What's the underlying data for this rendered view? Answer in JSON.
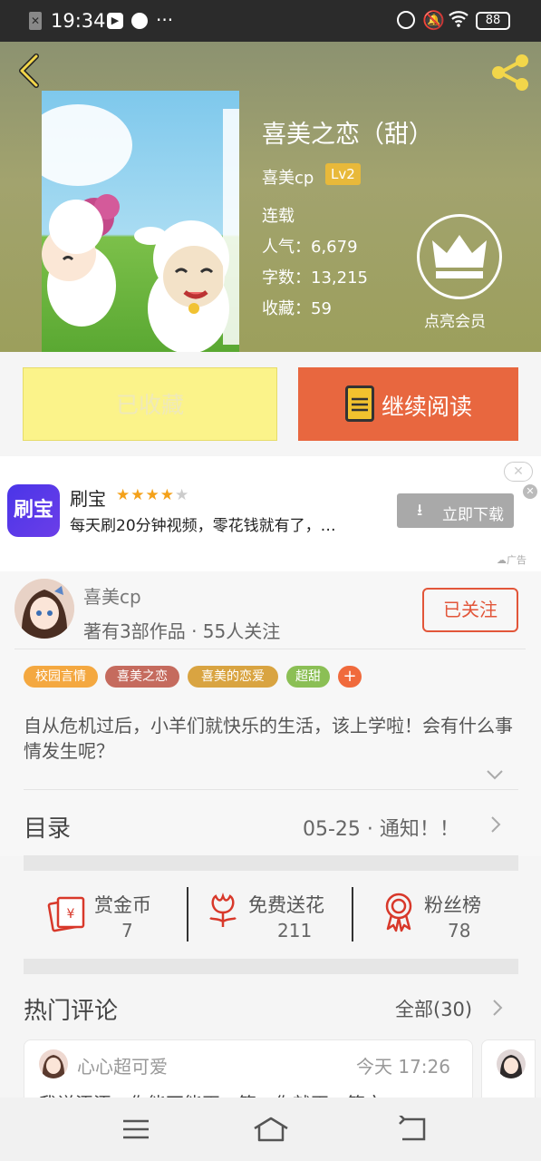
{
  "status_bar": {
    "time": "19:34",
    "dots": "···",
    "battery": "88"
  },
  "book": {
    "title": "喜美之恋（甜）",
    "author": "喜美cp",
    "level": "Lv2",
    "status": "连载",
    "popularity": "人气：6,679",
    "word_count": "字数：13,215",
    "favorites": "收藏：59",
    "vip_label": "点亮会员"
  },
  "actions": {
    "collected": "已收藏",
    "continue_reading": "继续阅读"
  },
  "ad": {
    "app_icon_text": "刷宝",
    "app_name": "刷宝",
    "rating": 4,
    "description": "每天刷20分钟视频，零花钱就有了，…",
    "download": "立即下载",
    "ad_label": "广告"
  },
  "author_card": {
    "name": "喜美cp",
    "stats": "著有3部作品 · 55人关注",
    "follow": "已关注"
  },
  "tags": [
    {
      "label": "校园言情",
      "color": "#f4a840"
    },
    {
      "label": "喜美之恋",
      "color": "#c56b5e"
    },
    {
      "label": "喜美的恋爱",
      "color": "#d9a441"
    },
    {
      "label": "超甜",
      "color": "#8bbf55"
    },
    {
      "label": "+",
      "color": "#f06a3c"
    }
  ],
  "synopsis": "自从危机过后，小羊们就快乐的生活，该上学啦！会有什么事情发生呢？",
  "toc": {
    "label": "目录",
    "latest": "05-25 · 通知！！"
  },
  "stats": [
    {
      "label": "赏金币",
      "value": "7"
    },
    {
      "label": "免费送花",
      "value": "211"
    },
    {
      "label": "粉丝榜",
      "value": "78"
    }
  ],
  "comments": {
    "title": "热门评论",
    "all": "全部(30)",
    "items": [
      {
        "user": "心心超可爱",
        "time": "今天 17:26",
        "text": "我说添添，你能不能再一篇，你就再一篇文"
      }
    ]
  }
}
